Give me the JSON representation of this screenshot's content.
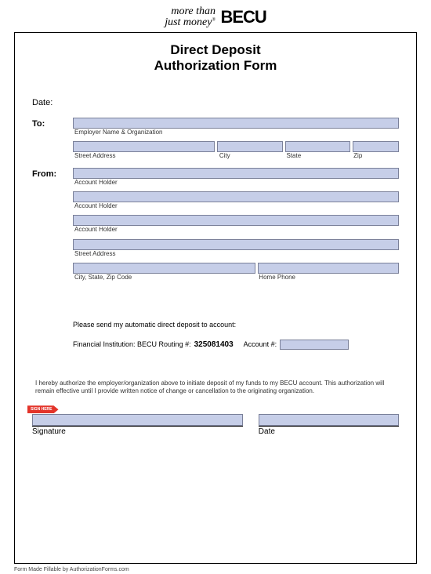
{
  "header": {
    "tagline_line1": "more than",
    "tagline_line2": "just money",
    "logo": "BECU"
  },
  "title_line1": "Direct Deposit",
  "title_line2": "Authorization Form",
  "date_label": "Date:",
  "to_label": "To:",
  "from_label": "From:",
  "to_fields": {
    "employer": "Employer Name & Organization",
    "street": "Street Address",
    "city": "City",
    "state": "State",
    "zip": "Zip"
  },
  "from_fields": {
    "account_holder": "Account Holder",
    "street": "Street Address",
    "city_state_zip": "City, State, Zip Code",
    "home_phone": "Home Phone"
  },
  "instruction": "Please send my automatic direct deposit to account:",
  "financial": {
    "prefix": "Financial Institution: BECU Routing #:",
    "routing": "325081403",
    "account_label": "Account #:"
  },
  "auth_text": "I hereby authorize the employer/organization above to initiate deposit of my funds to my BECU account. This authorization will remain effective until I provide written notice of change or cancellation to the originating organization.",
  "sign_here": "SIGN HERE",
  "signature_label": "Signature",
  "date_sig_label": "Date",
  "footer": "Form Made Fillable by AuthorizationForms.com"
}
